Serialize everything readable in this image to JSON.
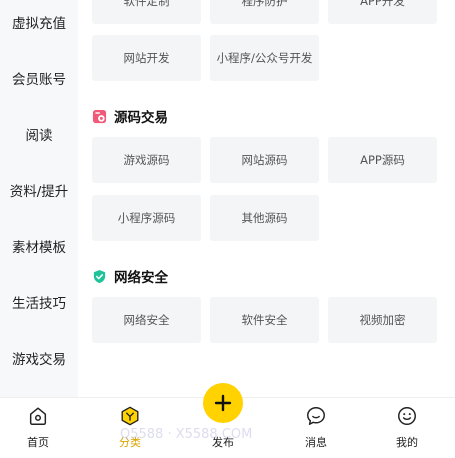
{
  "sidebar": {
    "items": [
      {
        "label": "虚拟充值"
      },
      {
        "label": "会员账号"
      },
      {
        "label": "阅读"
      },
      {
        "label": "资料/提升"
      },
      {
        "label": "素材模板"
      },
      {
        "label": "生活技巧"
      },
      {
        "label": "游戏交易"
      }
    ]
  },
  "top_partial": [
    "软件定制",
    "程序防护",
    "APP开发"
  ],
  "top_rows": [
    "网站开发",
    "小程序/公众号开发"
  ],
  "sections": [
    {
      "title": "源码交易",
      "icon": "source-trade-icon",
      "color": "#f0597a",
      "items": [
        "游戏源码",
        "网站源码",
        "APP源码",
        "小程序源码",
        "其他源码"
      ]
    },
    {
      "title": "网络安全",
      "icon": "shield-check-icon",
      "color": "#1fc39a",
      "items": [
        "网络安全",
        "软件安全",
        "视频加密"
      ]
    }
  ],
  "bottom_nav": {
    "tabs": [
      {
        "label": "首页",
        "icon": "home-icon"
      },
      {
        "label": "分类",
        "icon": "category-icon",
        "active": true
      },
      {
        "label": "发布",
        "icon": "plus-icon"
      },
      {
        "label": "消息",
        "icon": "message-icon"
      },
      {
        "label": "我的",
        "icon": "smile-icon"
      }
    ],
    "accent": "#ffd200"
  },
  "watermark": "Q5588 · X5588.COM"
}
